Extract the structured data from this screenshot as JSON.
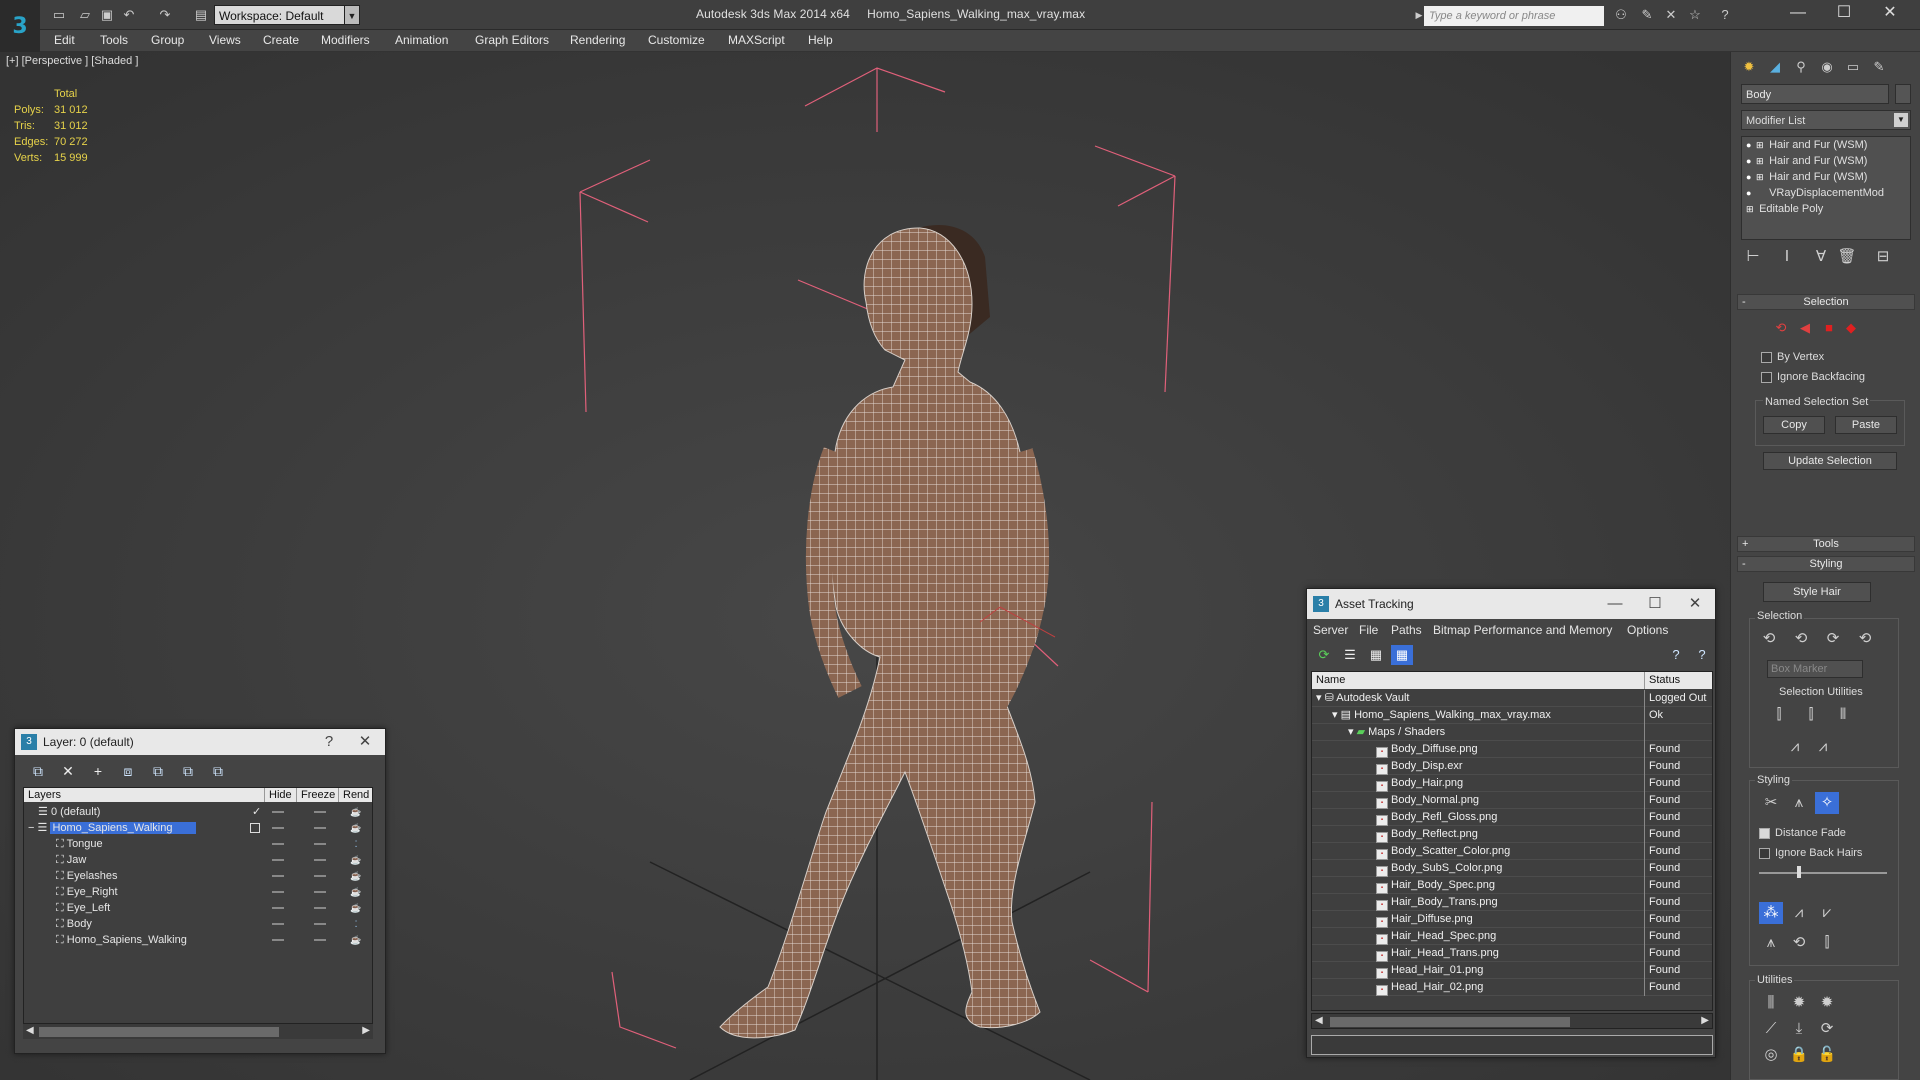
{
  "window": {
    "title": "Autodesk 3ds Max 2014 x64",
    "file": "Homo_Sapiens_Walking_max_vray.max",
    "workspace": "Workspace: Default",
    "search_placeholder": "Type a keyword or phrase"
  },
  "menu": [
    "Edit",
    "Tools",
    "Group",
    "Views",
    "Create",
    "Modifiers",
    "Animation",
    "Graph Editors",
    "Rendering",
    "Customize",
    "MAXScript",
    "Help"
  ],
  "viewport": {
    "label": "[+] [Perspective ] [Shaded ]",
    "stats": {
      "header": "Total",
      "rows": [
        {
          "k": "Polys:",
          "v": "31 012"
        },
        {
          "k": "Tris:",
          "v": "31 012"
        },
        {
          "k": "Edges:",
          "v": "70 272"
        },
        {
          "k": "Verts:",
          "v": "15 999"
        }
      ]
    }
  },
  "command_panel": {
    "object_name": "Body",
    "modifier_list": "Modifier List",
    "stack": [
      "Hair and Fur (WSM)",
      "Hair and Fur (WSM)",
      "Hair and Fur (WSM)",
      "VRayDisplacementMod",
      "Editable Poly"
    ],
    "selection": {
      "title": "Selection",
      "by_vertex": "By Vertex",
      "ignore_backfacing": "Ignore Backfacing",
      "named_selection_set": "Named Selection Set",
      "copy": "Copy",
      "paste": "Paste",
      "update_selection": "Update Selection"
    },
    "tools_title": "Tools",
    "styling": {
      "title": "Styling",
      "style_hair": "Style Hair",
      "selection_label": "Selection",
      "box_marker": "Box Marker",
      "selection_utilities": "Selection Utilities",
      "styling_label": "Styling",
      "distance_fade": "Distance Fade",
      "ignore_back_hairs": "Ignore Back Hairs",
      "utilities": "Utilities"
    }
  },
  "layer_dialog": {
    "title": "Layer: 0 (default)",
    "columns": [
      "Layers",
      "Hide",
      "Freeze",
      "Rend"
    ],
    "rows": [
      {
        "name": "0 (default)",
        "level": 0
      },
      {
        "name": "Homo_Sapiens_Walking",
        "level": 0
      },
      {
        "name": "Tongue",
        "level": 1
      },
      {
        "name": "Jaw",
        "level": 1
      },
      {
        "name": "Eyelashes",
        "level": 1
      },
      {
        "name": "Eye_Right",
        "level": 1
      },
      {
        "name": "Eye_Left",
        "level": 1
      },
      {
        "name": "Body",
        "level": 1
      },
      {
        "name": "Homo_Sapiens_Walking",
        "level": 1
      }
    ]
  },
  "asset_dialog": {
    "title": "Asset Tracking",
    "menu": [
      "Server",
      "File",
      "Paths",
      "Bitmap Performance and Memory",
      "Options"
    ],
    "columns": [
      "Name",
      "Status"
    ],
    "rows": [
      {
        "name": "Autodesk Vault",
        "status": "Logged Out",
        "level": 0
      },
      {
        "name": "Homo_Sapiens_Walking_max_vray.max",
        "status": "Ok",
        "level": 1
      },
      {
        "name": "Maps / Shaders",
        "status": "",
        "level": 2
      },
      {
        "name": "Body_Diffuse.png",
        "status": "Found",
        "level": 3
      },
      {
        "name": "Body_Disp.exr",
        "status": "Found",
        "level": 3
      },
      {
        "name": "Body_Hair.png",
        "status": "Found",
        "level": 3
      },
      {
        "name": "Body_Normal.png",
        "status": "Found",
        "level": 3
      },
      {
        "name": "Body_Refl_Gloss.png",
        "status": "Found",
        "level": 3
      },
      {
        "name": "Body_Reflect.png",
        "status": "Found",
        "level": 3
      },
      {
        "name": "Body_Scatter_Color.png",
        "status": "Found",
        "level": 3
      },
      {
        "name": "Body_SubS_Color.png",
        "status": "Found",
        "level": 3
      },
      {
        "name": "Hair_Body_Spec.png",
        "status": "Found",
        "level": 3
      },
      {
        "name": "Hair_Body_Trans.png",
        "status": "Found",
        "level": 3
      },
      {
        "name": "Hair_Diffuse.png",
        "status": "Found",
        "level": 3
      },
      {
        "name": "Hair_Head_Spec.png",
        "status": "Found",
        "level": 3
      },
      {
        "name": "Hair_Head_Trans.png",
        "status": "Found",
        "level": 3
      },
      {
        "name": "Head_Hair_01.png",
        "status": "Found",
        "level": 3
      },
      {
        "name": "Head_Hair_02.png",
        "status": "Found",
        "level": 3
      }
    ]
  },
  "colors": {
    "stats": "#e6d24a",
    "selection_highlight": "#3a6fd8",
    "bounding_box": "#e0607a",
    "mesh_skin": "#8b6651",
    "wire": "#ffffff"
  }
}
